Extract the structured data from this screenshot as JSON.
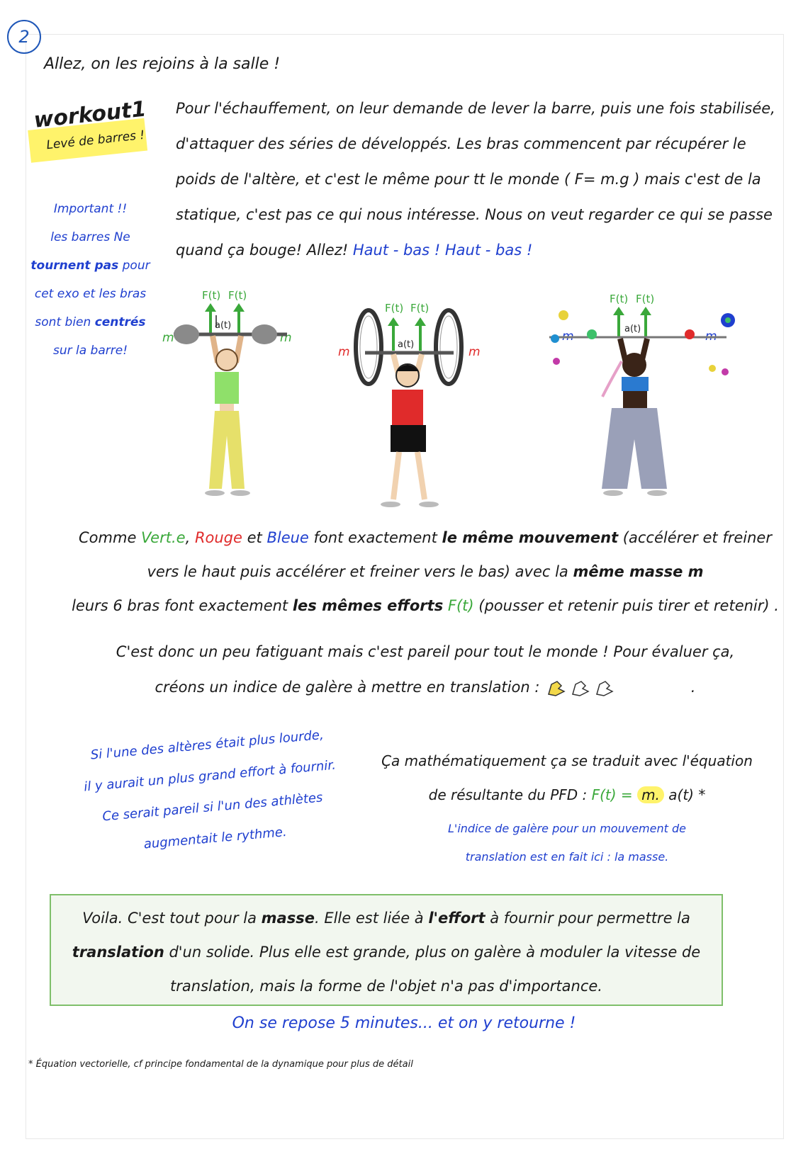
{
  "page_number": "2",
  "intro": "Allez, on les rejoins à la salle !",
  "badge": {
    "title": "workout1",
    "subtitle": "Levé de barres !"
  },
  "side_note": {
    "l1": "Important !!",
    "l2": "les barres Ne",
    "l3a": "tournent pas",
    "l3b": " pour",
    "l4": "cet exo et les bras",
    "l5a": "sont bien ",
    "l5b": "centrés",
    "l6": "sur la barre!"
  },
  "para1": {
    "text": "Pour l'échauffement, on leur demande de lever la barre, puis une fois stabilisée, d'attaquer des séries de développés. Les bras commencent par récupérer le poids de l'altère, et c'est le même pour tt le monde ( F= m.g ) mais c'est de la statique, c'est pas ce qui nous intéresse. Nous on veut regarder ce qui se passe quand ça bouge! Allez! ",
    "blue": "Haut - bas ! Haut - bas !"
  },
  "figures": [
    {
      "force1": "F(t)",
      "force2": "F(t)",
      "accel": "a(t)",
      "mass": "m",
      "color": "#3aa83a"
    },
    {
      "force1": "F(t)",
      "force2": "F(t)",
      "accel": "a(t)",
      "mass": "m",
      "color": "#e02b2b"
    },
    {
      "force1": "F(t)",
      "force2": "F(t)",
      "accel": "a(t)",
      "mass": "m",
      "color": "#1f3fcf"
    }
  ],
  "para2": {
    "a": "Comme ",
    "vert": "Vert.e",
    "b": ", ",
    "rouge": "Rouge",
    "c": " et ",
    "bleue": "Bleue",
    "d": " font exactement ",
    "same_move": "le même mouvement",
    "e": " (accélérer et freiner vers le haut puis accélérer et freiner vers le bas) avec la ",
    "same_mass": "même masse m",
    "f": "leurs 6 bras font exactement ",
    "same_effort": "les mêmes efforts",
    "g": " ",
    "ft": "F(t)",
    "h": " (pousser et retenir puis tirer et retenir) ."
  },
  "para3": {
    "l1": "C'est donc un peu fatiguant mais c'est pareil pour tout le monde ! Pour évaluer ça,",
    "l2": "créons un indice de galère à mettre en translation :",
    "end": "."
  },
  "left_note": {
    "l1": "Si l'une des altères était plus lourde,",
    "l2": "il y aurait un plus grand effort à fournir.",
    "l3": "Ce serait pareil si l'un des athlètes",
    "l4": "augmentait le rythme."
  },
  "right_block": {
    "l1": "Ça mathématiquement ça se traduit avec l'équation",
    "l2": "de résultante du PFD :",
    "eq_f": "F(t)",
    "eq_eq": " = ",
    "eq_m": "m.",
    "eq_a": " a(t) *",
    "note1": "L'indice de galère pour un mouvement de",
    "note2": "translation est en fait ici : la masse."
  },
  "summary": {
    "a": "Voila. C'est tout pour la ",
    "masse": "masse",
    "b": ". Elle est liée à ",
    "effort": "l'effort",
    "c": " à fournir pour permettre la",
    "translation": "translation",
    "d": " d'un solide. Plus elle est grande, plus on galère à moduler la vitesse de",
    "e": "translation, mais la forme de l'objet n'a pas d'importance."
  },
  "rest": "On se repose 5 minutes... et on y retourne !",
  "footnote": "* Équation vectorielle, cf principe fondamental de la dynamique pour plus de détail"
}
